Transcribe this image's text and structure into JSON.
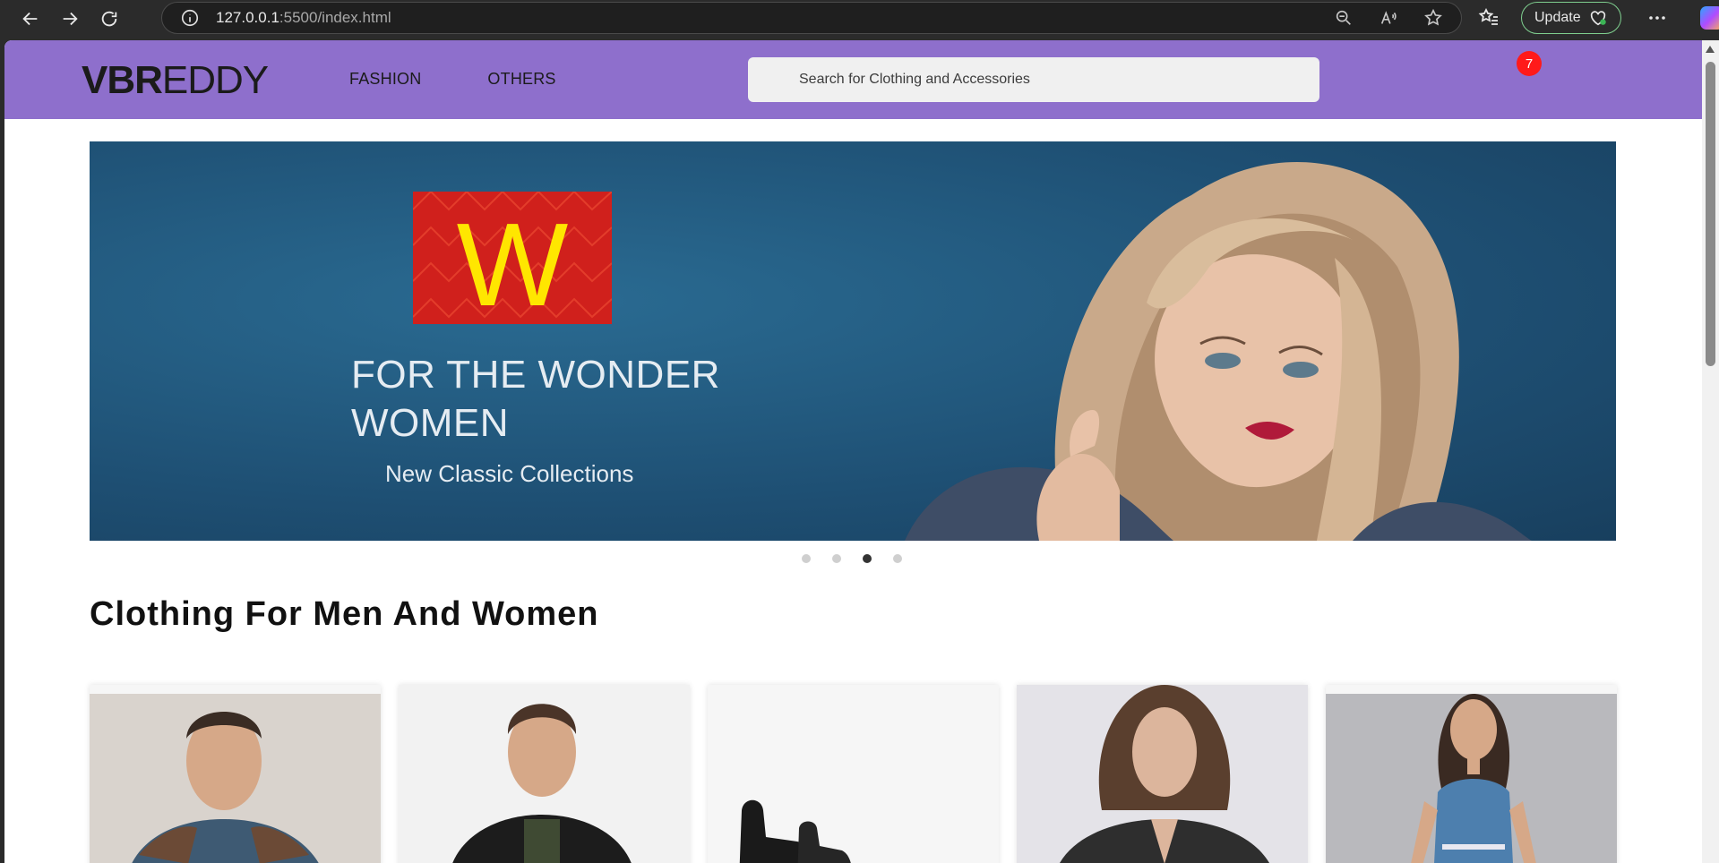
{
  "browser": {
    "url_host": "127.0.0.1",
    "url_rest": ":5500/index.html",
    "update_label": "Update"
  },
  "header": {
    "logo_bold": "VBR",
    "logo_rest": "EDDY",
    "menu": [
      {
        "label": "FASHION"
      },
      {
        "label": "OTHERS"
      }
    ],
    "search_placeholder": "Search for Clothing and Accessories",
    "cart_count": "7",
    "colors": {
      "header_bg": "#8e6fcc",
      "badge": "#ff1a1a"
    }
  },
  "banner": {
    "logo_letter": "W",
    "headline": "FOR THE WONDER WOMEN",
    "subline": "New Classic Collections",
    "active_slide": 3,
    "slide_count": 4
  },
  "section": {
    "title": "Clothing For Men And Women"
  },
  "cards": [
    {
      "icon": "man-sweater-image"
    },
    {
      "icon": "man-jacket-image"
    },
    {
      "icon": "boots-image"
    },
    {
      "icon": "woman-leather-jacket-image"
    },
    {
      "icon": "woman-denim-dress-image"
    }
  ]
}
